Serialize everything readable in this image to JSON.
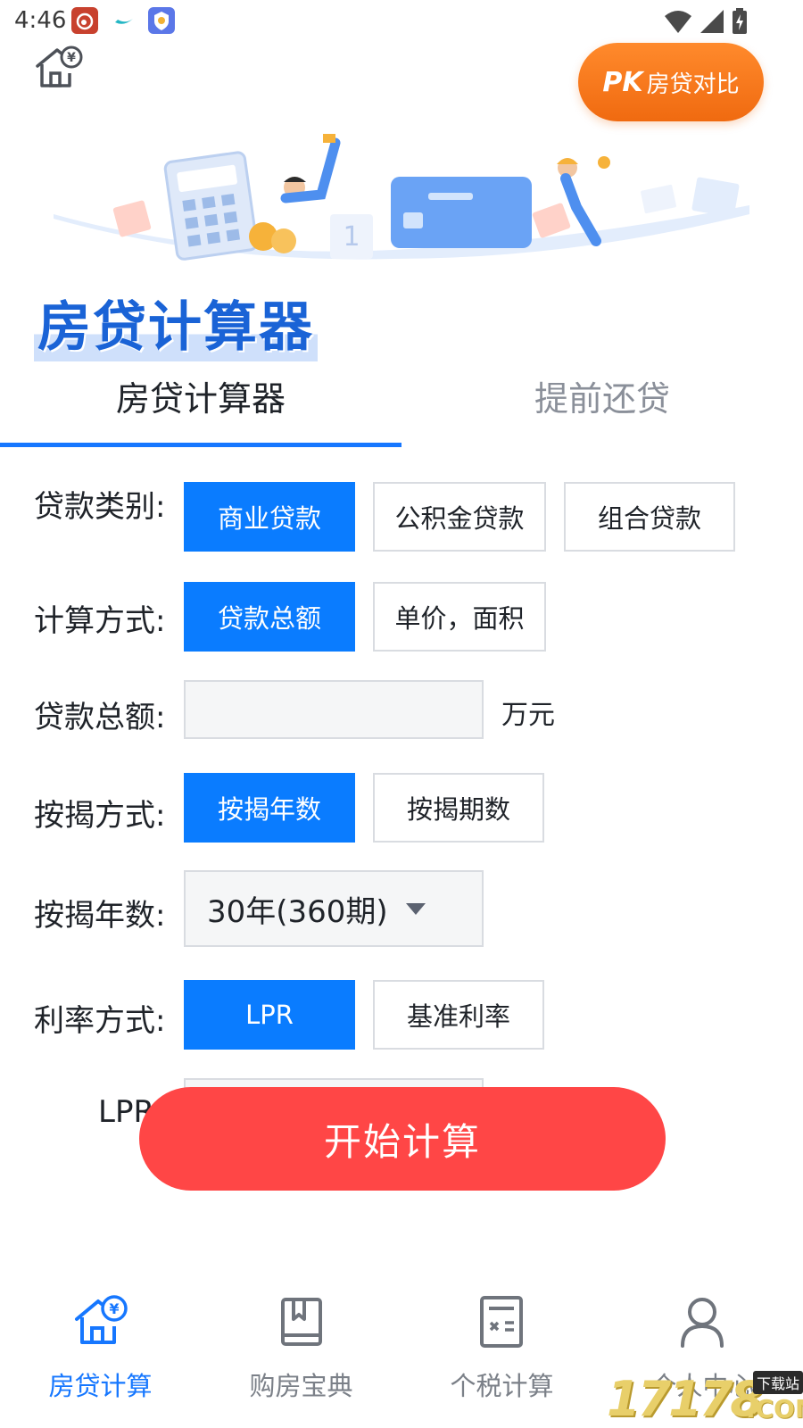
{
  "status_bar": {
    "time": "4:46"
  },
  "header": {
    "pk_mark": "PK",
    "pk_label": "房贷对比"
  },
  "banner": {
    "title": "房贷计算器"
  },
  "tabs": [
    {
      "label": "房贷计算器",
      "active": true
    },
    {
      "label": "提前还贷",
      "active": false
    }
  ],
  "form": {
    "loan_type": {
      "label": "贷款类别:",
      "options": [
        "商业贷款",
        "公积金贷款",
        "组合贷款"
      ],
      "selected": "商业贷款"
    },
    "calc_method": {
      "label": "计算方式:",
      "options": [
        "贷款总额",
        "单价，面积"
      ],
      "selected": "贷款总额"
    },
    "loan_amount": {
      "label": "贷款总额:",
      "value": "",
      "unit": "万元"
    },
    "mortgage_method": {
      "label": "按揭方式:",
      "options": [
        "按揭年数",
        "按揭期数"
      ],
      "selected": "按揭年数"
    },
    "mortgage_years": {
      "label": "按揭年数:",
      "selected": "30年(360期)"
    },
    "rate_method": {
      "label": "利率方式:",
      "options": [
        "LPR",
        "基准利率"
      ],
      "selected": "LPR"
    },
    "lpr": {
      "label": "LPR"
    }
  },
  "start_button": {
    "label": "开始计算"
  },
  "bottom_nav": [
    {
      "label": "房贷计算",
      "icon": "house-yen-icon",
      "active": true
    },
    {
      "label": "购房宝典",
      "icon": "book-icon",
      "active": false
    },
    {
      "label": "个税计算",
      "icon": "tax-calculator-icon",
      "active": false
    },
    {
      "label": "个人中心",
      "icon": "person-icon",
      "active": false
    }
  ],
  "watermark": {
    "number": "17178",
    "suffix": ".COM",
    "tag": "下载站"
  },
  "colors": {
    "primary": "#0a7cff",
    "tab_underline": "#1677ff",
    "start_button": "#ff4646",
    "pk_button": "#f57a1c"
  }
}
